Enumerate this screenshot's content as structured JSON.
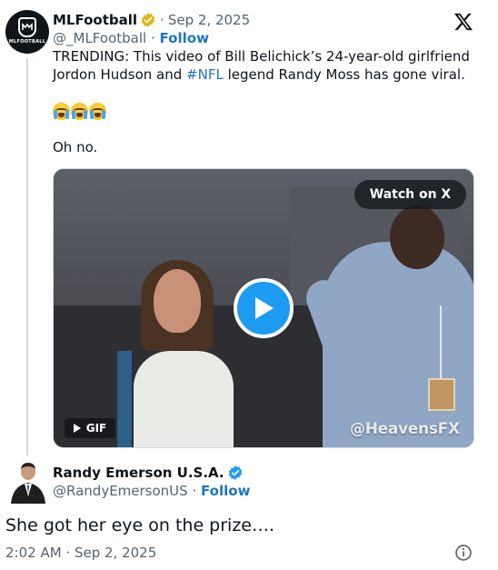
{
  "quoted_tweet": {
    "author_name": "MLFootball",
    "avatar_text": "MLFOOTBALL",
    "date_separator": "·",
    "date": "Sep 2, 2025",
    "handle": "@_MLFootball",
    "follow_separator": "·",
    "follow_label": "Follow",
    "text_before_hashtag": "TRENDING: This video of Bill Belichick’s 24-year-old girlfriend Jordon Hudson and ",
    "hashtag": "#NFL",
    "text_after_hashtag": " legend Randy Moss has gone viral.",
    "emojis": [
      "loudly-crying-face",
      "loudly-crying-face",
      "loudly-crying-face"
    ],
    "second_line": "Oh no.",
    "media": {
      "watch_label": "Watch on X",
      "gif_label": "GIF",
      "watermark": "@HeavensFX"
    }
  },
  "reply": {
    "author_name": "Randy Emerson U.S.A.",
    "handle": "@RandyEmersonUS",
    "follow_separator": "·",
    "follow_label": "Follow",
    "text": "She got her eye on the prize….",
    "timestamp": "2:02 AM · Sep 2, 2025"
  },
  "colors": {
    "accent": "#1d9bf0",
    "link": "#1d76c5",
    "secondary_text": "#536471",
    "primary_text": "#0f1419",
    "verified_gold": "#e2b719",
    "verified_blue": "#1d9bf0"
  },
  "icons": {
    "x_logo": "x-logo-icon",
    "play": "play-icon",
    "info": "info-icon"
  }
}
